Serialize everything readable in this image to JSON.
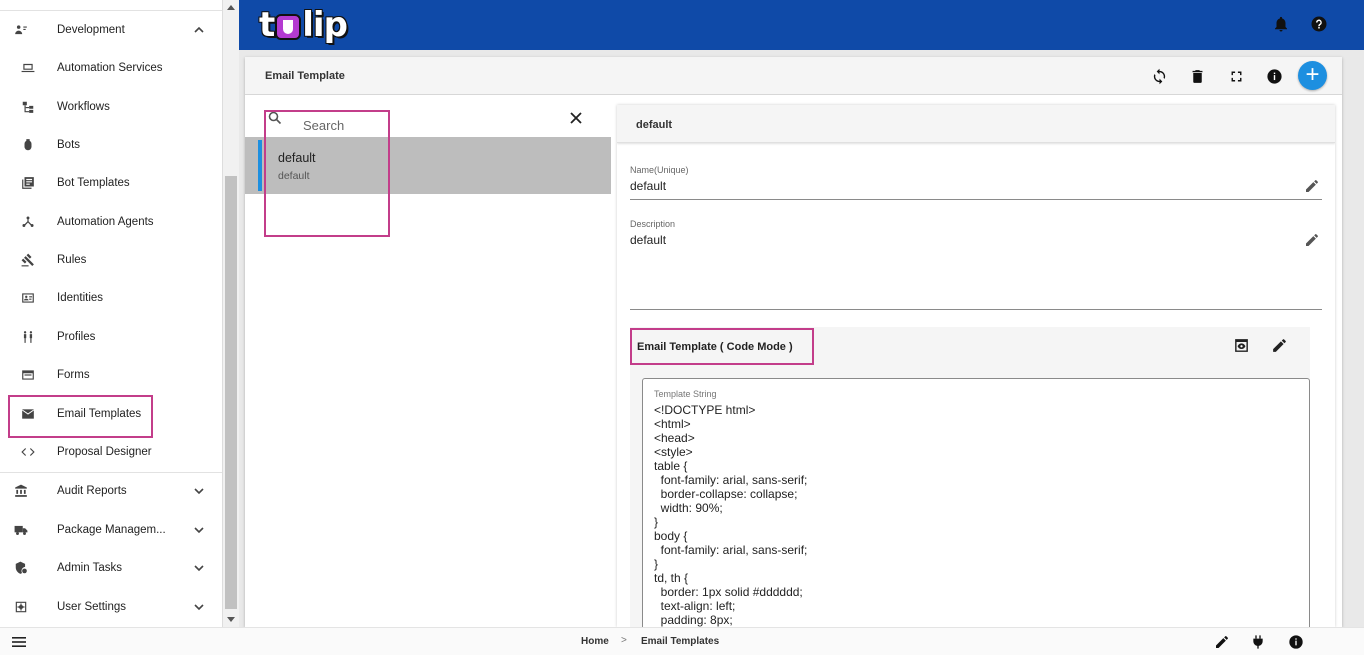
{
  "sidebar": {
    "items": [
      {
        "label": "Development",
        "icon": "people-code-icon",
        "expandable": true,
        "expanded": true
      },
      {
        "label": "Automation Services",
        "icon": "laptop-icon"
      },
      {
        "label": "Workflows",
        "icon": "workflow-icon"
      },
      {
        "label": "Bots",
        "icon": "bot-icon"
      },
      {
        "label": "Bot Templates",
        "icon": "library-icon"
      },
      {
        "label": "Automation Agents",
        "icon": "hub-icon"
      },
      {
        "label": "Rules",
        "icon": "gavel-icon"
      },
      {
        "label": "Identities",
        "icon": "id-card-icon"
      },
      {
        "label": "Profiles",
        "icon": "people-icon"
      },
      {
        "label": "Forms",
        "icon": "form-icon"
      },
      {
        "label": "Email Templates",
        "icon": "mail-icon",
        "selected": true
      },
      {
        "label": "Proposal Designer",
        "icon": "code-icon"
      },
      {
        "label": "Audit Reports",
        "icon": "bank-icon",
        "expandable": true
      },
      {
        "label": "Package Managem...",
        "icon": "truck-icon",
        "expandable": true
      },
      {
        "label": "Admin Tasks",
        "icon": "admin-shield-icon",
        "expandable": true
      },
      {
        "label": "User Settings",
        "icon": "settings-box-icon",
        "expandable": true
      }
    ]
  },
  "header": {
    "logo_text_1": "t",
    "logo_text_2": "lip"
  },
  "card": {
    "title": "Email Template"
  },
  "list": {
    "search_placeholder": "Search",
    "items": [
      {
        "title": "default",
        "subtitle": "default"
      }
    ]
  },
  "detail": {
    "title": "default",
    "name_label": "Name(Unique)",
    "name_value": "default",
    "description_label": "Description",
    "description_value": "default",
    "template_section_title": "Email Template ( Code Mode )",
    "template_label": "Template String",
    "template_code": "<!DOCTYPE html>\n<html>\n<head>\n<style>\ntable {\n  font-family: arial, sans-serif;\n  border-collapse: collapse;\n  width: 90%;\n}\nbody {\n  font-family: arial, sans-serif;\n}\ntd, th {\n  border: 1px solid #dddddd;\n  text-align: left;\n  padding: 8px;"
  },
  "breadcrumb": {
    "home": "Home",
    "separator": ">",
    "current": "Email Templates"
  },
  "colors": {
    "topbar": "#0f4aa8",
    "accent": "#1d8fe0",
    "highlight": "#c33d8a",
    "selected_item": "#bdbdbd"
  }
}
